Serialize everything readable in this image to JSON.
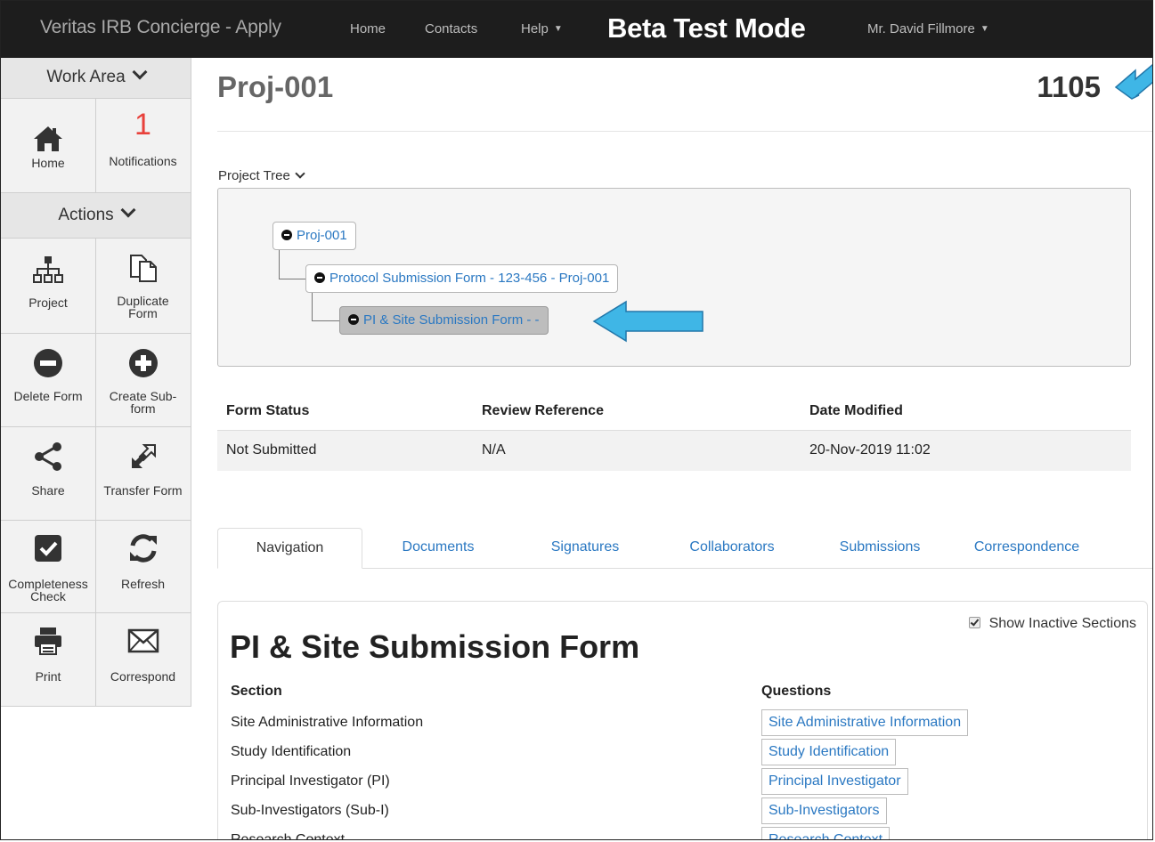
{
  "navbar": {
    "brand": "Veritas IRB Concierge - Apply",
    "home": "Home",
    "contacts": "Contacts",
    "help": "Help",
    "beta": "Beta Test Mode",
    "user": "Mr. David Fillmore"
  },
  "sidebar": {
    "work_area": "Work Area",
    "home": "Home",
    "notifications_count": "1",
    "notifications": "Notifications",
    "actions": "Actions",
    "project": "Project",
    "duplicate_line1": "Duplicate",
    "duplicate_line2": "Form",
    "delete_form": "Delete Form",
    "create_line1": "Create Sub-",
    "create_line2": "form",
    "share": "Share",
    "transfer_form": "Transfer Form",
    "completeness_line1": "Completeness",
    "completeness_line2": "Check",
    "refresh": "Refresh",
    "print": "Print",
    "correspond": "Correspond"
  },
  "header": {
    "title": "Proj-001",
    "id": "1105"
  },
  "project_tree": {
    "label": "Project Tree",
    "nodes": [
      "Proj-001",
      "Protocol Submission Form - 123-456 - Proj-001",
      "PI & Site Submission Form - -"
    ]
  },
  "status_table": {
    "headers": [
      "Form Status",
      "Review Reference",
      "Date Modified"
    ],
    "row": [
      "Not Submitted",
      "N/A",
      "20-Nov-2019 11:02"
    ]
  },
  "tabs": [
    "Navigation",
    "Documents",
    "Signatures",
    "Collaborators",
    "Submissions",
    "Correspondence"
  ],
  "form": {
    "show_inactive": "Show Inactive Sections",
    "title": "PI & Site Submission Form",
    "section_header": "Section",
    "questions_header": "Questions",
    "sections": [
      "Site Administrative Information",
      "Study Identification",
      "Principal Investigator (PI)",
      "Sub-Investigators (Sub-I)",
      "Research Context"
    ],
    "questions": [
      "Site Administrative Information",
      "Study Identification",
      "Principal Investigator",
      "Sub-Investigators",
      "Research Context"
    ]
  },
  "colors": {
    "navbar_bg": "#1d1d1d",
    "link": "#2a78c2",
    "notification": "#e8413b",
    "arrow": "#3fb6e6"
  }
}
